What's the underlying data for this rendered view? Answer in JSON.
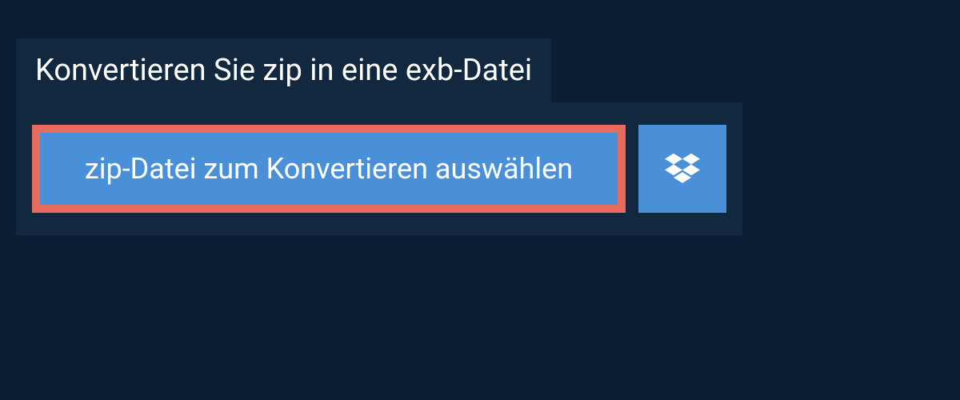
{
  "header": {
    "title": "Konvertieren Sie zip in eine exb-Datei"
  },
  "upload": {
    "select_file_label": "zip-Datei zum Konvertieren auswählen"
  },
  "colors": {
    "background": "#0a1e33",
    "panel": "#12283f",
    "button": "#4a90d9",
    "highlight_border": "#e96b5f",
    "text": "#ffffff"
  }
}
